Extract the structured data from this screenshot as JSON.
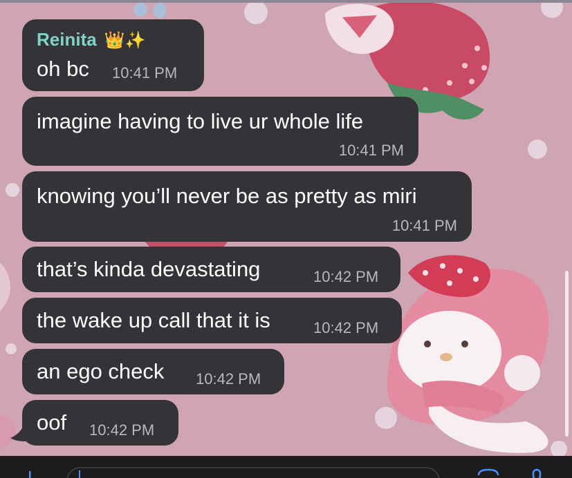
{
  "chat": {
    "sender": {
      "name": "Reinita",
      "emoji": "👑✨"
    },
    "messages": [
      {
        "text": "oh bc",
        "time": "10:41 PM"
      },
      {
        "text": "imagine having to live ur whole life",
        "time": "10:41 PM"
      },
      {
        "text": "knowing you’ll never be as pretty as miri",
        "time": "10:41 PM"
      },
      {
        "text": "that’s kinda devastating",
        "time": "10:42 PM"
      },
      {
        "text": "the wake up call that it is",
        "time": "10:42 PM"
      },
      {
        "text": "an ego check",
        "time": "10:42 PM"
      },
      {
        "text": "oof",
        "time": "10:42 PM"
      }
    ]
  },
  "theme": {
    "bubble_color": "#343438",
    "sender_color": "#7fd3c9",
    "wallpaper_color": "#cfa5b4",
    "input_bar_color": "#1c1c1e"
  },
  "input_bar": {
    "icons": [
      "plus-icon",
      "camera-icon",
      "microphone-icon"
    ]
  }
}
